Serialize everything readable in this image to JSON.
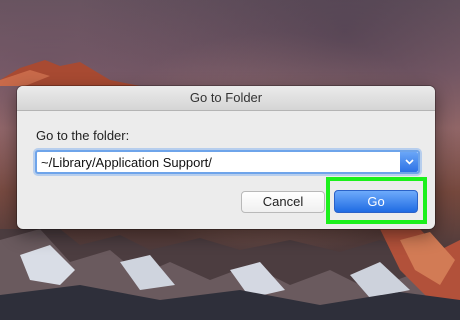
{
  "dialog": {
    "title": "Go to Folder",
    "prompt": "Go to the folder:",
    "path_value": "~/Library/Application Support/",
    "cancel_label": "Cancel",
    "go_label": "Go"
  },
  "colors": {
    "accent": "#2d72e6",
    "highlight": "#1cf01c"
  }
}
